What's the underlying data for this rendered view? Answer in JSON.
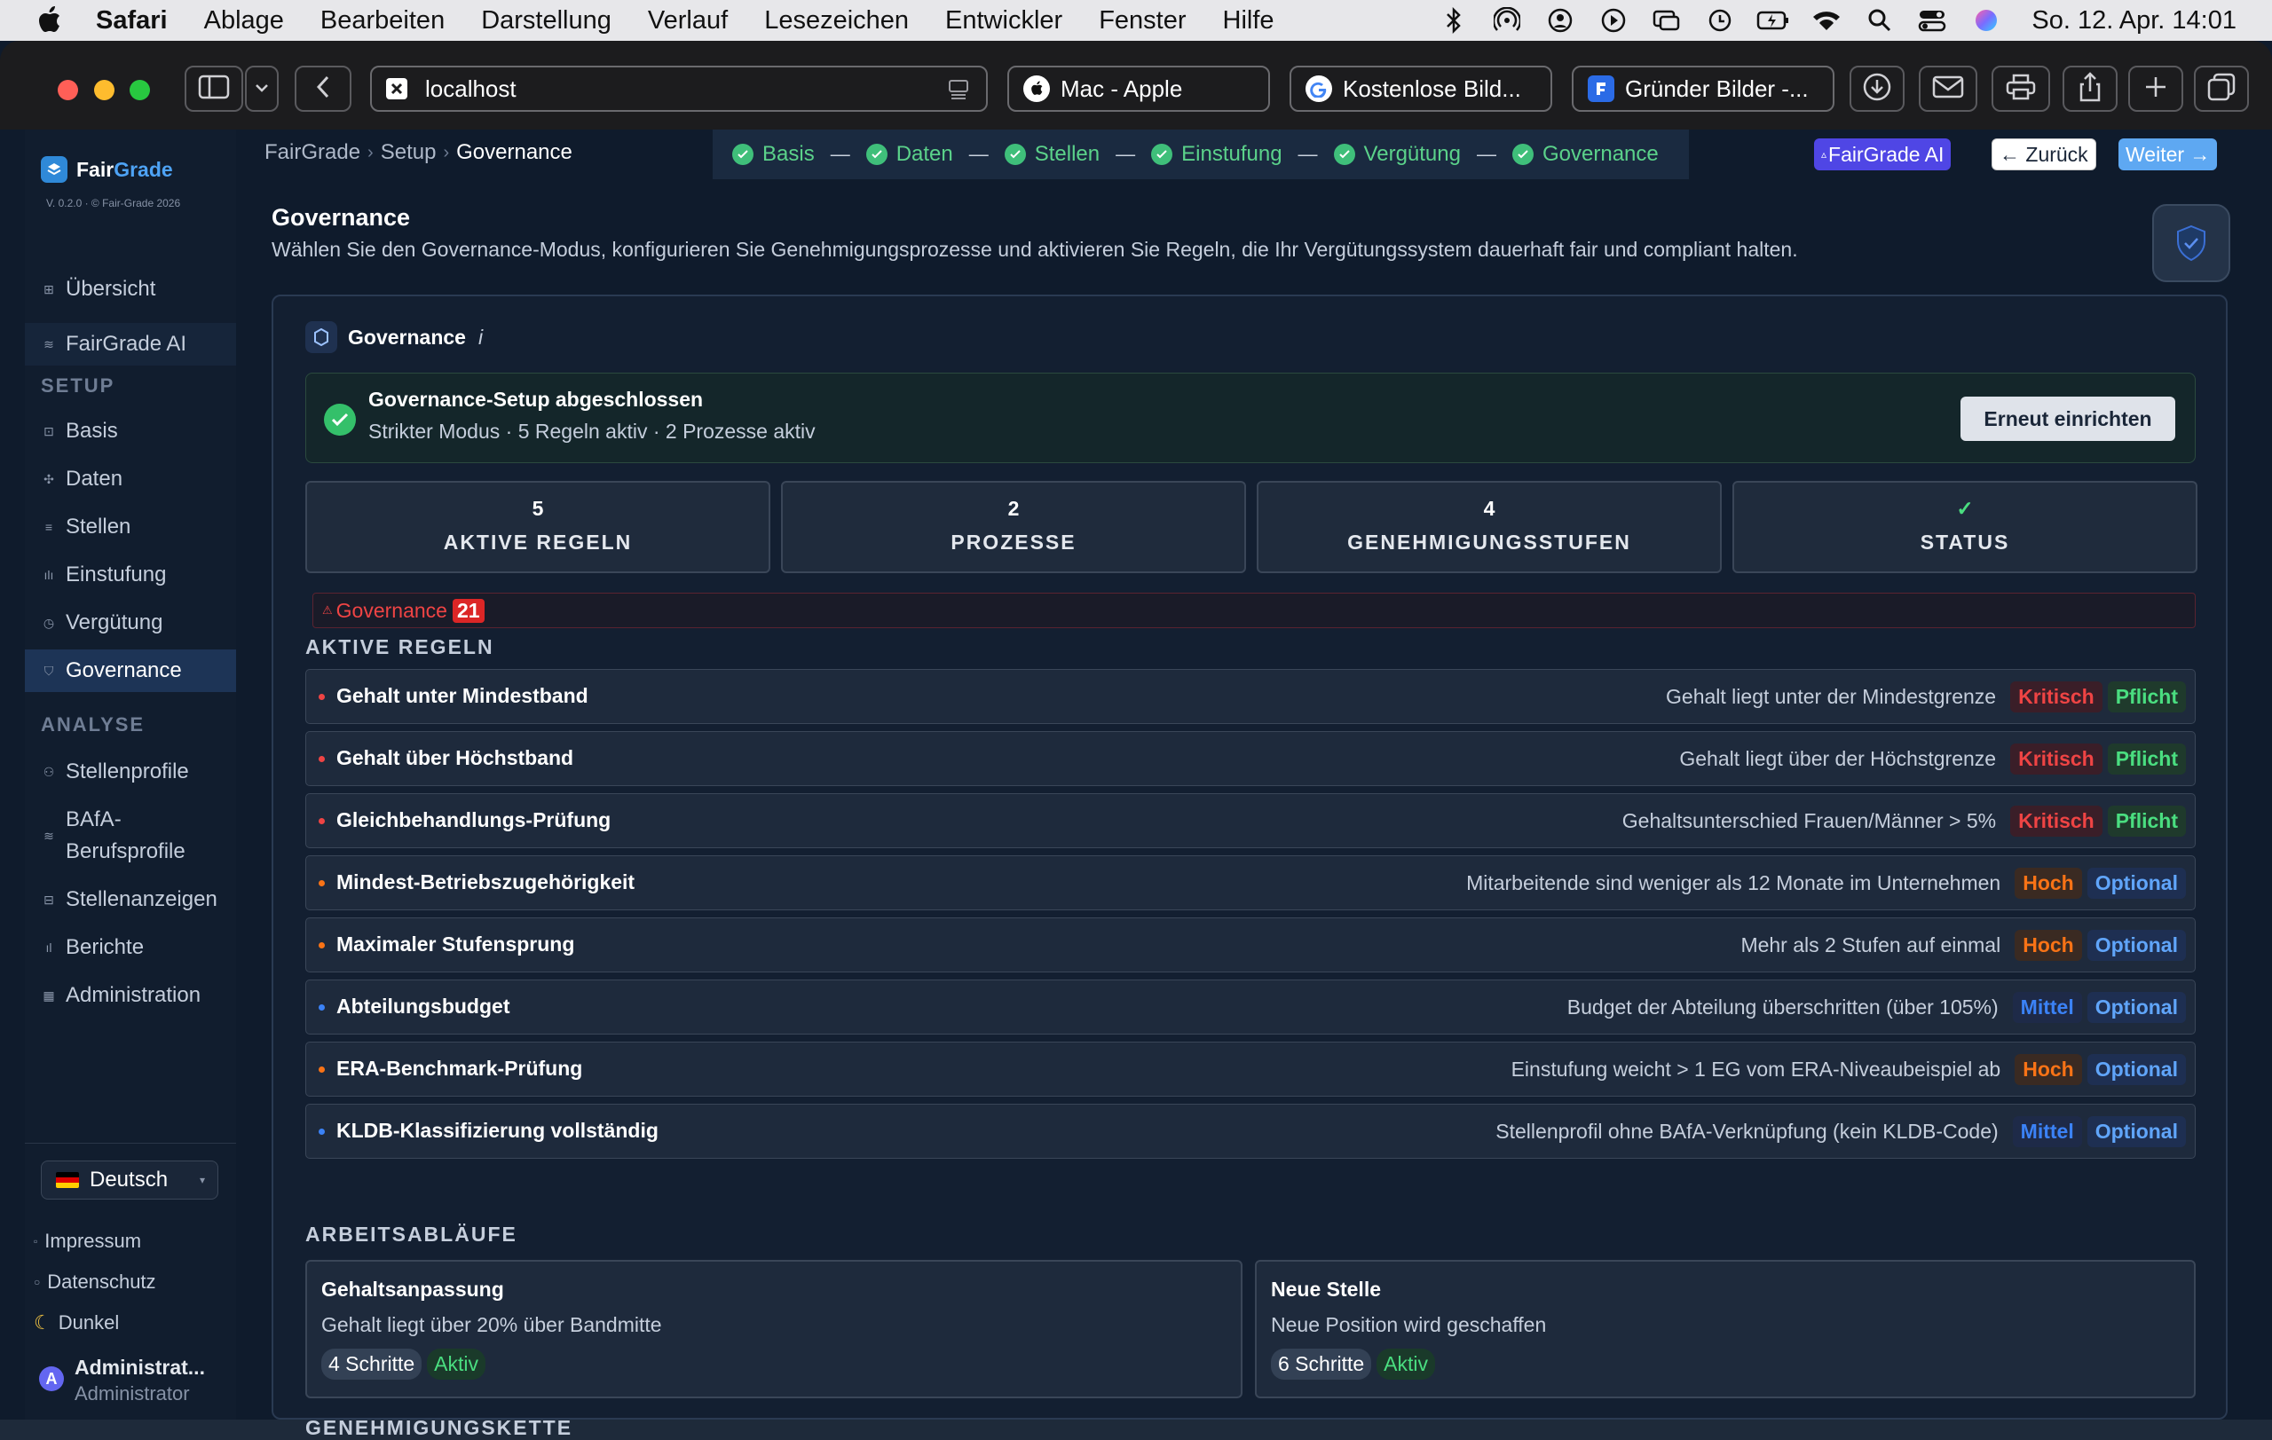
{
  "menubar": {
    "app": "Safari",
    "items": [
      "Ablage",
      "Bearbeiten",
      "Darstellung",
      "Verlauf",
      "Lesezeichen",
      "Entwickler",
      "Fenster",
      "Hilfe"
    ],
    "clock": "So. 12. Apr.  14:01"
  },
  "browser": {
    "url": "localhost",
    "tabs": [
      "Mac - Apple",
      "Kostenlose Bild...",
      "Gründer Bilder -..."
    ]
  },
  "sidebar": {
    "brand_a": "Fair",
    "brand_b": "Grade",
    "version": "V. 0.2.0 · © Fair-Grade 2026",
    "overview": "Übersicht",
    "ai": "FairGrade AI",
    "setup_title": "SETUP",
    "setup_items": [
      "Basis",
      "Daten",
      "Stellen",
      "Einstufung",
      "Vergütung",
      "Governance"
    ],
    "analysis_title": "ANALYSE",
    "analysis_items": [
      "Stellenprofile",
      "BAfA-\nBerufsprofile",
      "Stellenanzeigen",
      "Berichte",
      "Administration"
    ],
    "language": "Deutsch",
    "impressum": "Impressum",
    "privacy": "Datenschutz",
    "theme": "Dunkel",
    "user_name": "Administrat...",
    "user_role": "Administrator"
  },
  "header": {
    "breadcrumb": [
      "FairGrade",
      "Setup",
      "Governance"
    ],
    "steps": [
      "Basis",
      "Daten",
      "Stellen",
      "Einstufung",
      "Vergütung",
      "Governance"
    ],
    "ai_button": "FairGrade AI",
    "back_button": "← Zurück",
    "next_button": "Weiter →"
  },
  "page": {
    "title": "Governance",
    "subtitle": "Wählen Sie den Governance-Modus, konfigurieren Sie Genehmigungsprozesse und aktivieren Sie Regeln, die Ihr Vergütungssystem dauerhaft fair und compliant halten."
  },
  "card": {
    "title": "Governance",
    "info": "i",
    "done_title": "Governance-Setup abgeschlossen",
    "done_sub": "Strikter Modus · 5 Regeln aktiv · 2 Prozesse aktiv",
    "redo_button": "Erneut einrichten",
    "stats": [
      {
        "value": "5",
        "label": "AKTIVE REGELN"
      },
      {
        "value": "2",
        "label": "PROZESSE"
      },
      {
        "value": "4",
        "label": "GENEHMIGUNGSSTUFEN"
      },
      {
        "value": "✓",
        "label": "STATUS"
      }
    ],
    "alert_label": "Governance",
    "alert_count": "21",
    "rules_title": "AKTIVE REGELN",
    "rules": [
      {
        "name": "Gehalt unter Mindestband",
        "desc": "Gehalt liegt unter der Mindestgrenze",
        "severity": "Kritisch",
        "type": "Pflicht"
      },
      {
        "name": "Gehalt über Höchstband",
        "desc": "Gehalt liegt über der Höchstgrenze",
        "severity": "Kritisch",
        "type": "Pflicht"
      },
      {
        "name": "Gleichbehandlungs-Prüfung",
        "desc": "Gehaltsunterschied Frauen/Männer > 5%",
        "severity": "Kritisch",
        "type": "Pflicht"
      },
      {
        "name": "Mindest-Betriebszugehörigkeit",
        "desc": "Mitarbeitende sind weniger als 12 Monate im Unternehmen",
        "severity": "Hoch",
        "type": "Optional"
      },
      {
        "name": "Maximaler Stufensprung",
        "desc": "Mehr als 2 Stufen auf einmal",
        "severity": "Hoch",
        "type": "Optional"
      },
      {
        "name": "Abteilungsbudget",
        "desc": "Budget der Abteilung überschritten (über 105%)",
        "severity": "Mittel",
        "type": "Optional"
      },
      {
        "name": "ERA-Benchmark-Prüfung",
        "desc": "Einstufung weicht > 1 EG vom ERA-Niveaubeispiel ab",
        "severity": "Hoch",
        "type": "Optional"
      },
      {
        "name": "KLDB-Klassifizierung vollständig",
        "desc": "Stellenprofil ohne BAfA-Verknüpfung (kein KLDB-Code)",
        "severity": "Mittel",
        "type": "Optional"
      }
    ],
    "workflows_title": "ARBEITSABLÄUFE",
    "workflows": [
      {
        "name": "Gehaltsanpassung",
        "desc": "Gehalt liegt über 20% über Bandmitte",
        "steps": "4 Schritte",
        "status": "Aktiv"
      },
      {
        "name": "Neue Stelle",
        "desc": "Neue Position wird geschaffen",
        "steps": "6 Schritte",
        "status": "Aktiv"
      }
    ],
    "chain_title": "GENEHMIGUNGSKETTE"
  },
  "colors": {
    "critical": "#ef4444",
    "high": "#f97316",
    "medium": "#3b82f6",
    "required": "#4ade80",
    "optional": "#60a5fa",
    "accent": "#4ea3f5"
  }
}
